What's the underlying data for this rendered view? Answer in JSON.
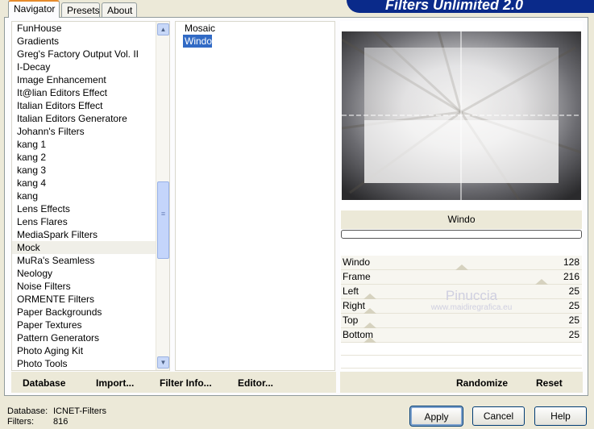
{
  "banner": {
    "title": "Filters Unlimited 2.0"
  },
  "tabs": [
    {
      "label": "Navigator",
      "active": true
    },
    {
      "label": "Presets",
      "active": false
    },
    {
      "label": "About",
      "active": false
    }
  ],
  "categories": {
    "items": [
      "FunHouse",
      "Gradients",
      "Greg's Factory Output Vol. II",
      "I-Decay",
      "Image Enhancement",
      "It@lian Editors Effect",
      "Italian Editors Effect",
      "Italian Editors Generatore",
      "Johann's Filters",
      "kang 1",
      "kang 2",
      "kang 3",
      "kang 4",
      "kang",
      "Lens Effects",
      "Lens Flares",
      "MediaSpark Filters",
      "Mock",
      "MuRa's Seamless",
      "Neology",
      "Noise Filters",
      "ORMENTE Filters",
      "Paper Backgrounds",
      "Paper Textures",
      "Pattern Generators",
      "Photo Aging Kit",
      "Photo Tools"
    ],
    "selected": "Mock",
    "scroll_position": 0.6
  },
  "filters": {
    "items": [
      "Mosaic",
      "Windo"
    ],
    "selected": "Windo"
  },
  "filter_name": "Windo",
  "progress": 0,
  "sliders": [
    {
      "label": "Windo",
      "value": "128",
      "level": 0.5
    },
    {
      "label": "Frame",
      "value": "216",
      "level": 0.85
    },
    {
      "label": "Left",
      "value": "25",
      "level": 0.1
    },
    {
      "label": "Right",
      "value": "25",
      "level": 0.1
    },
    {
      "label": "Top",
      "value": "25",
      "level": 0.1
    },
    {
      "label": "Bottom",
      "value": "25",
      "level": 0.1
    }
  ],
  "left_buttons": {
    "database": "Database",
    "import": "Import...",
    "filter_info": "Filter Info...",
    "editor": "Editor..."
  },
  "right_buttons": {
    "randomize": "Randomize",
    "reset": "Reset"
  },
  "info": {
    "database_label": "Database:",
    "database_value": "ICNET-Filters",
    "filters_label": "Filters:",
    "filters_value": "816"
  },
  "dialog_buttons": {
    "apply": "Apply",
    "cancel": "Cancel",
    "help": "Help"
  },
  "watermark": {
    "name": "Pinuccia",
    "site": "www.maidiregrafica.eu"
  }
}
